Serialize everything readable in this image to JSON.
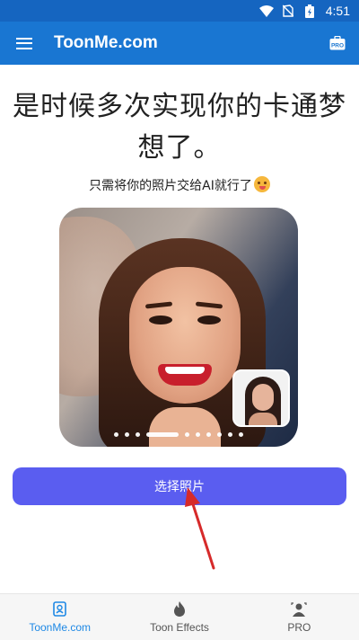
{
  "status_bar": {
    "time": "4:51"
  },
  "app_bar": {
    "title": "ToonMe.com",
    "pro_badge": "PRO"
  },
  "content": {
    "headline": "是时候多次实现你的卡通梦想了。",
    "subline": "只需将你的照片交给AI就行了",
    "carousel": {
      "total_slides": 10,
      "active_index": 3
    },
    "select_photo_button": "选择照片"
  },
  "bottom_nav": {
    "items": [
      {
        "label": "ToonMe.com",
        "icon": "toonme-logo-icon",
        "active": true
      },
      {
        "label": "Toon Effects",
        "icon": "flame-icon",
        "active": false
      },
      {
        "label": "PRO",
        "icon": "pro-person-icon",
        "active": false
      }
    ]
  },
  "colors": {
    "status_bar": "#1565c0",
    "app_bar": "#1976d2",
    "primary_button": "#5a5df0",
    "nav_active": "#1e88e5",
    "annotation_arrow": "#d62a2a"
  }
}
